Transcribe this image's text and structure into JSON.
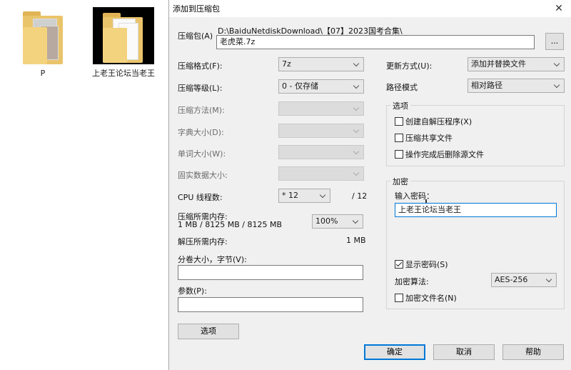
{
  "desktop": {
    "icons": [
      {
        "label": "P"
      },
      {
        "label": "上老王论坛当老王"
      }
    ]
  },
  "dialog": {
    "title": "添加到压缩包",
    "archive": {
      "label": "压缩包(A)",
      "path": "D:\\BaiduNetdiskDownload\\【07】2023国考合集\\",
      "filename": "老虎菜.7z",
      "browse_label": "..."
    },
    "left": {
      "format_label": "压缩格式(F):",
      "format_value": "7z",
      "level_label": "压缩等级(L):",
      "level_value": "0 - 仅存储",
      "method_label": "压缩方法(M):",
      "dict_label": "字典大小(D):",
      "word_label": "单词大小(W):",
      "solid_label": "固实数据大小:",
      "cpu_label": "CPU 线程数:",
      "cpu_value": "* 12",
      "cpu_total": "/ 12",
      "mem_label": "压缩所需内存:",
      "mem_detail": "1 MB / 8125 MB / 8125 MB",
      "mem_percent": "100%",
      "decomp_label": "解压所需内存:",
      "decomp_value": "1 MB",
      "split_label": "分卷大小，字节(V):",
      "split_value": "",
      "params_label": "参数(P):",
      "params_value": "",
      "options_button": "选项"
    },
    "right": {
      "update_label": "更新方式(U):",
      "update_value": "添加并替换文件",
      "pathmode_label": "路径模式",
      "pathmode_value": "相对路径",
      "options_group": "选项",
      "opt_sfx": "创建自解压程序(X)",
      "opt_shared": "压缩共享文件",
      "opt_delete": "操作完成后删除源文件",
      "encrypt_group": "加密",
      "password_label": "输入密码：",
      "password_value": "上老王论坛当老王",
      "show_password": "显示密码(S)",
      "enc_method_label": "加密算法:",
      "enc_method_value": "AES-256",
      "encrypt_names": "加密文件名(N)"
    },
    "buttons": {
      "ok": "确定",
      "cancel": "取消",
      "help": "帮助"
    }
  }
}
